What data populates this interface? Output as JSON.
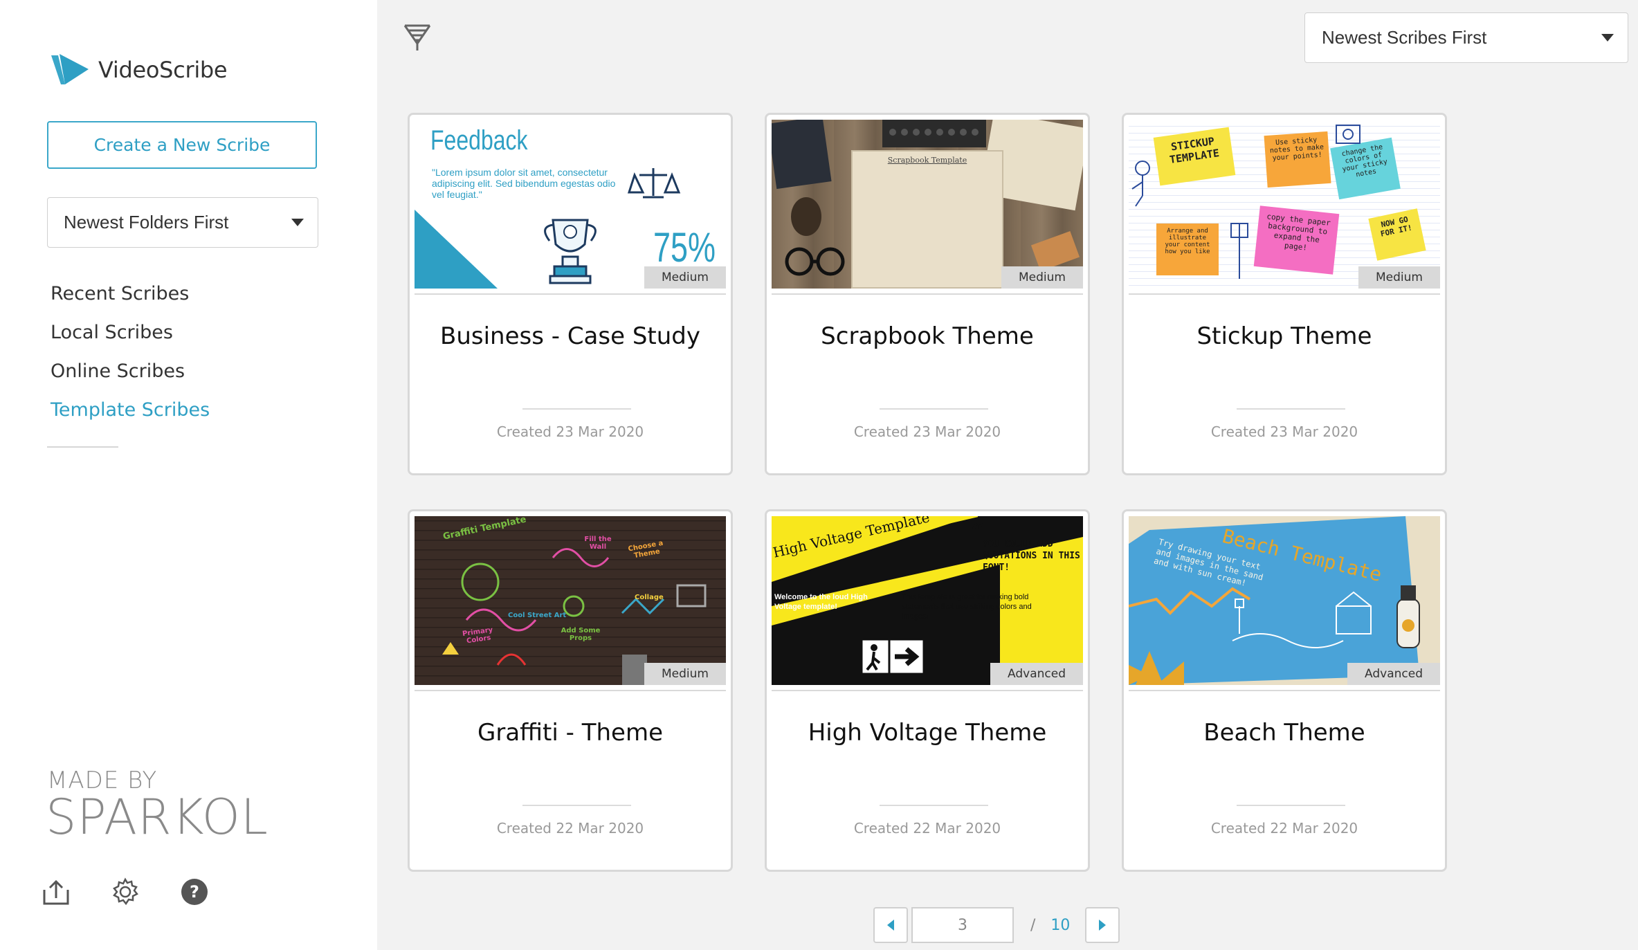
{
  "app": {
    "name": "VideoScribe"
  },
  "sidebar": {
    "create_label": "Create a New Scribe",
    "folder_sort": "Newest Folders First",
    "nav": [
      {
        "label": "Recent Scribes",
        "active": false
      },
      {
        "label": "Local Scribes",
        "active": false
      },
      {
        "label": "Online Scribes",
        "active": false
      },
      {
        "label": "Template Scribes",
        "active": true
      }
    ],
    "made_by": "MADE BY",
    "brand": "SPARKOL",
    "icons": [
      "upload-icon",
      "gear-icon",
      "help-icon"
    ]
  },
  "toolbar": {
    "scribe_sort": "Newest Scribes First",
    "filter_icon": "filter-icon"
  },
  "accent_color": "#2e9fc4",
  "cards": [
    {
      "title": "Business - Case Study",
      "date": "Created 23 Mar 2020",
      "level": "Medium",
      "thumb": {
        "heading": "Feedback",
        "body": "\"Lorem ipsum dolor sit amet, consectetur adipiscing elit. Sed bibendum egestas odio vel feugiat.\"",
        "stat": "75%"
      }
    },
    {
      "title": "Scrapbook Theme",
      "date": "Created 23 Mar 2020",
      "level": "Medium",
      "thumb": {
        "heading": "Scrapbook Template"
      }
    },
    {
      "title": "Stickup Theme",
      "date": "Created 23 Mar 2020",
      "level": "Medium",
      "thumb": {
        "notes": [
          "STICKUP TEMPLATE",
          "Use sticky notes to make your points!",
          "change the colors of your sticky notes",
          "Arrange and illustrate your content how you like",
          "copy the paper background to expand the page!",
          "NOW GO FOR IT!"
        ]
      }
    },
    {
      "title": "Graffiti - Theme",
      "date": "Created 22 Mar 2020",
      "level": "Medium",
      "thumb": {
        "words": [
          "Graffiti Template",
          "Fill the Wall",
          "Choose a Theme",
          "Cool Street Art",
          "Collage",
          "Primary Colors",
          "Add Some Props"
        ]
      }
    },
    {
      "title": "High Voltage Theme",
      "date": "Created 22 Mar 2020",
      "level": "Advanced",
      "thumb": {
        "banner": "High Voltage Template",
        "quote": "YOU COULD ADD QUOTATIONS IN THIS FONT!",
        "welcome": "Welcome to the loud High Voltage template!",
        "desc": "This template is great for making bold statements that use striking colors and images!"
      }
    },
    {
      "title": "Beach Theme",
      "date": "Created 22 Mar 2020",
      "level": "Advanced",
      "thumb": {
        "heading": "Beach Template",
        "body": "Try drawing your text and images in the sand and with sun cream!"
      }
    }
  ],
  "pagination": {
    "current": "3",
    "separator": "/",
    "total": "10"
  }
}
